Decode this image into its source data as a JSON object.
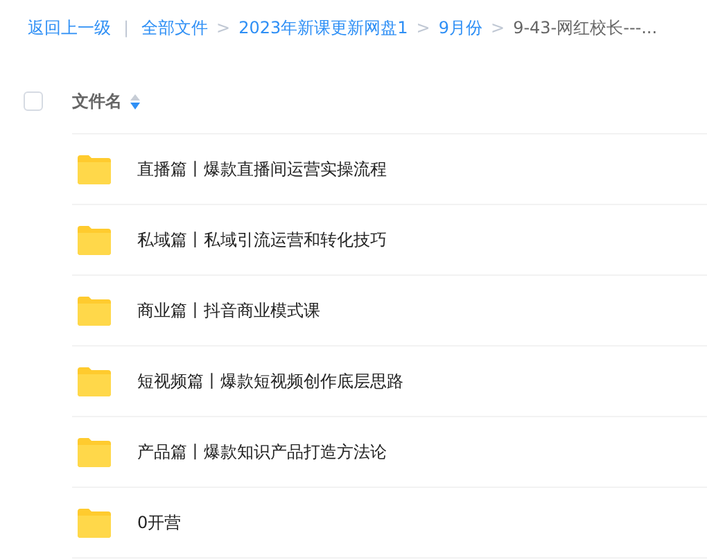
{
  "breadcrumb": {
    "back": "返回上一级",
    "divider": "|",
    "separator": ">",
    "items": [
      {
        "label": "全部文件",
        "current": false
      },
      {
        "label": "2023年新课更新网盘1",
        "current": false
      },
      {
        "label": "9月份",
        "current": false
      },
      {
        "label": "9-43-网红校长---...",
        "current": true
      }
    ]
  },
  "header": {
    "checked": false,
    "column": "文件名",
    "sort_descending": true
  },
  "files": [
    {
      "name": "直播篇丨爆款直播间运营实操流程"
    },
    {
      "name": "私域篇丨私域引流运营和转化技巧"
    },
    {
      "name": "商业篇丨抖音商业模式课"
    },
    {
      "name": "短视频篇丨爆款短视频创作底层思路"
    },
    {
      "name": "产品篇丨爆款知识产品打造方法论"
    },
    {
      "name": "0开营"
    }
  ]
}
